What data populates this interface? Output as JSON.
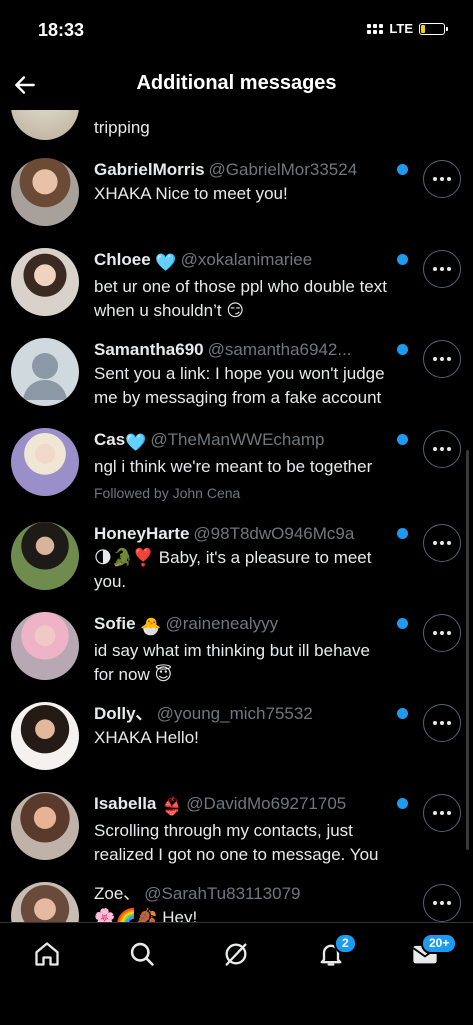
{
  "status_bar": {
    "time": "18:33",
    "network": "LTE",
    "battery_level": 0.2
  },
  "header": {
    "title": "Additional messages"
  },
  "partial_row": {
    "message": "tripping"
  },
  "conversations": [
    {
      "name": "GabrielMorris",
      "name_emoji": "",
      "handle": "@GabrielMor33524",
      "message": "XHAKA Nice to meet you!",
      "followed_by": "",
      "unread": true
    },
    {
      "name": "Chloee",
      "name_emoji": "🩵",
      "handle": "@xokalanimariee",
      "message": "bet ur one of those ppl who double text when u shouldn’t 😏",
      "followed_by": "",
      "unread": true
    },
    {
      "name": "Samantha690",
      "name_emoji": "",
      "handle": "@samantha6942...",
      "message": "Sent you a link: I hope you won't judge me by messaging from a fake account",
      "followed_by": "",
      "unread": true
    },
    {
      "name": "Cas",
      "name_emoji": "🩵",
      "handle": "@TheManWWEchamp",
      "message": "ngl i think we're meant to be together",
      "followed_by": "Followed by John Cena",
      "unread": true
    },
    {
      "name": "HoneyHarte",
      "name_emoji": "",
      "handle": "@98T8dwO946Mc9a",
      "message": "🌗🐊❣️ Baby, it's a pleasure to meet you.",
      "followed_by": "",
      "unread": true
    },
    {
      "name": "Sofie",
      "name_emoji": "🐣",
      "handle": "@rainenealyyy",
      "message": "id say what im thinking but ill behave for now 😇",
      "followed_by": "",
      "unread": true
    },
    {
      "name": "Dolly、",
      "name_emoji": "",
      "handle": "@young_mich75532",
      "message": "XHAKA Hello!",
      "followed_by": "",
      "unread": true
    },
    {
      "name": "Isabella",
      "name_emoji": "👙",
      "handle": "@DavidMo69271705",
      "message": "Scrolling through my contacts, just realized I got no one to message. You",
      "followed_by": "",
      "unread": true
    },
    {
      "name": "Zoe、",
      "name_emoji": "",
      "handle": "@SarahTu83113079",
      "message": "🌸🌈🍂 Hey!",
      "followed_by": "",
      "unread": false
    }
  ],
  "nav": {
    "items": [
      "home-icon",
      "search-icon",
      "grok-icon",
      "notifications-icon",
      "messages-icon"
    ],
    "notifications_badge": "2",
    "messages_badge": "20+"
  },
  "colors": {
    "accent": "#1d9bf0",
    "text": "#e7e9ea",
    "secondary": "#71767b",
    "background": "#000000"
  }
}
